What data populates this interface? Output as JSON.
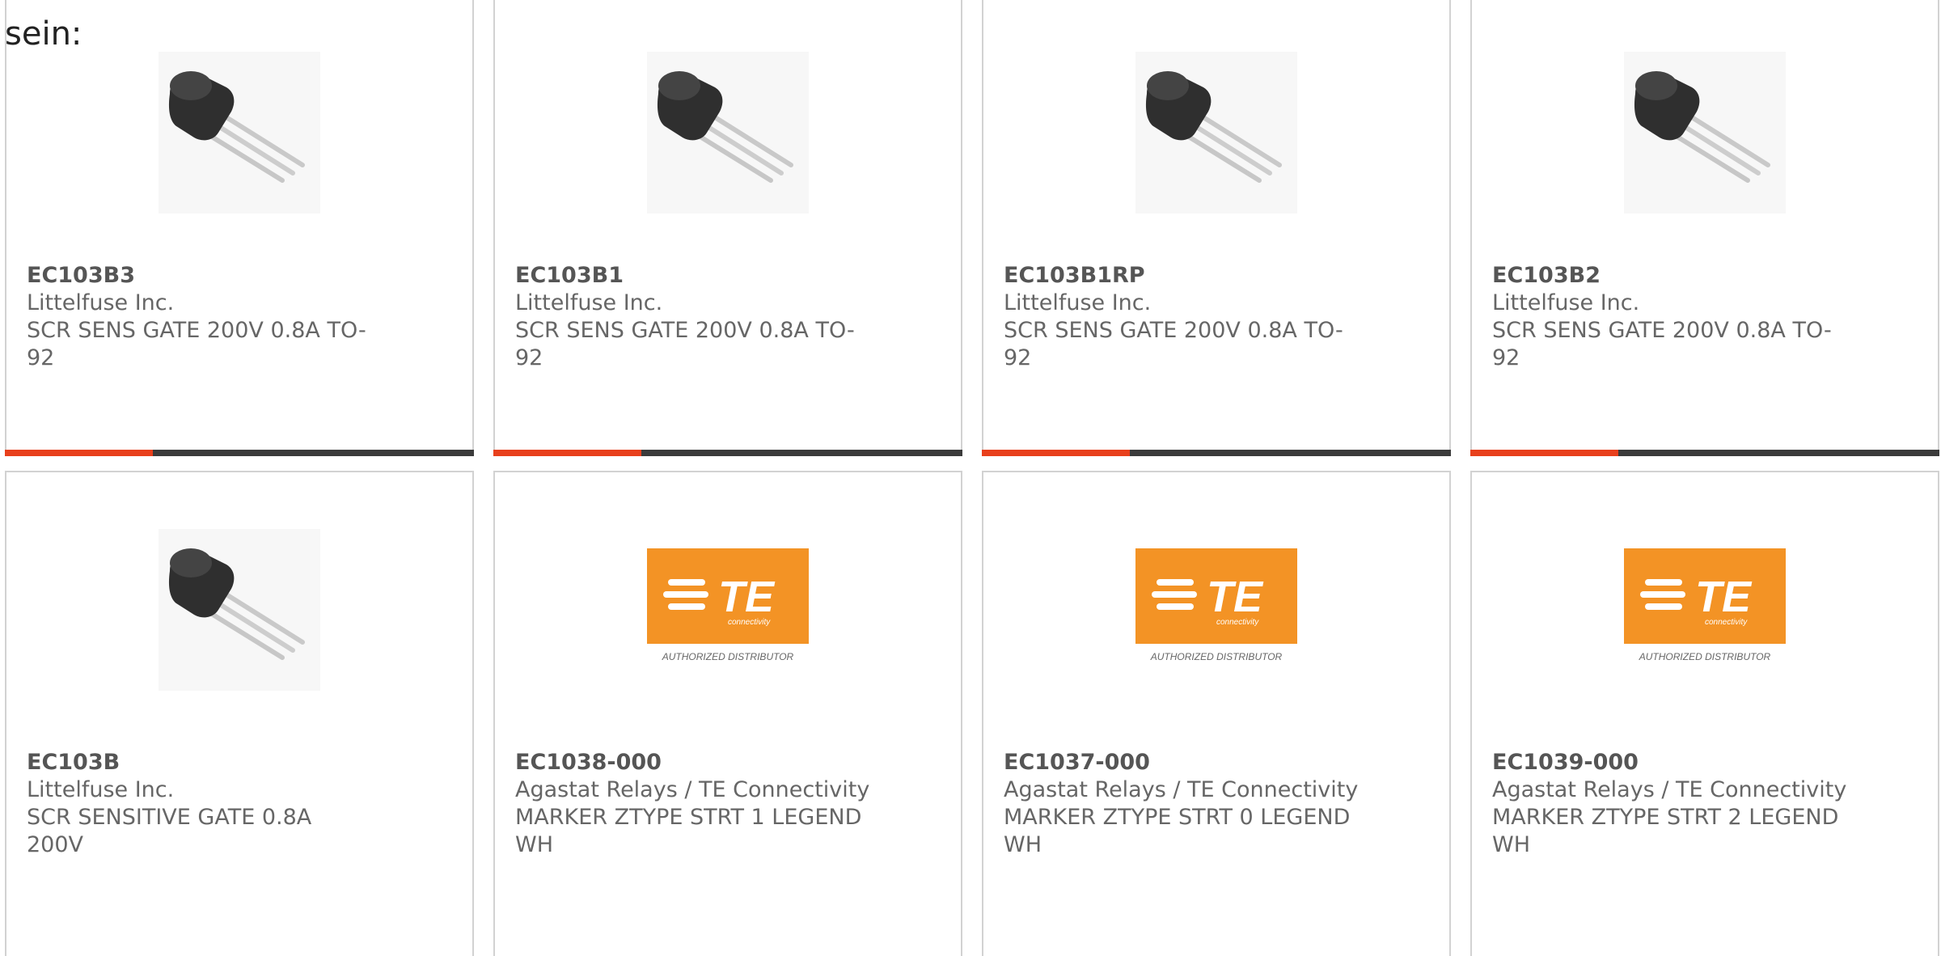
{
  "intro": "sein:",
  "products": [
    {
      "part": "EC103B3",
      "manufacturer": "Littelfuse Inc.",
      "description": "SCR SENS GATE 200V 0.8A TO-92",
      "image": "to92-transistor",
      "progress": 0.316
    },
    {
      "part": "EC103B1",
      "manufacturer": "Littelfuse Inc.",
      "description": "SCR SENS GATE 200V 0.8A TO-92",
      "image": "to92-transistor",
      "progress": 0.316
    },
    {
      "part": "EC103B1RP",
      "manufacturer": "Littelfuse Inc.",
      "description": "SCR SENS GATE 200V 0.8A TO-92",
      "image": "to92-transistor",
      "progress": 0.316
    },
    {
      "part": "EC103B2",
      "manufacturer": "Littelfuse Inc.",
      "description": "SCR SENS GATE 200V 0.8A TO-92",
      "image": "to92-transistor",
      "progress": 0.316
    },
    {
      "part": "EC103B",
      "manufacturer": "Littelfuse Inc.",
      "description": "SCR SENSITIVE GATE 0.8A 200V",
      "image": "to92-transistor"
    },
    {
      "part": "EC1038-000",
      "manufacturer": "Agastat Relays / TE Connectivity",
      "description": "MARKER ZTYPE STRT 1 LEGEND WH",
      "image": "te-logo"
    },
    {
      "part": "EC1037-000",
      "manufacturer": "Agastat Relays / TE Connectivity",
      "description": "MARKER ZTYPE STRT 0 LEGEND WH",
      "image": "te-logo"
    },
    {
      "part": "EC1039-000",
      "manufacturer": "Agastat Relays / TE Connectivity",
      "description": "MARKER ZTYPE STRT 2 LEGEND WH",
      "image": "te-logo"
    }
  ],
  "te_logo": {
    "wordmark": "TE",
    "tagline": "connectivity",
    "caption": "AUTHORIZED DISTRIBUTOR"
  },
  "colors": {
    "accent": "#e8401c",
    "bar_dark": "#3b3b3b",
    "te_orange": "#f39325",
    "border": "#d2d2d2"
  }
}
